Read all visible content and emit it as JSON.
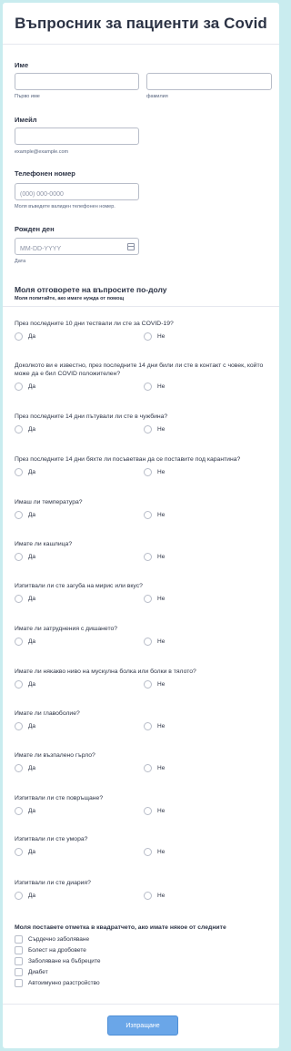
{
  "form": {
    "title": "Въпросник за пациенти за Covid",
    "name": {
      "label": "Име",
      "first_sub": "Първо име",
      "last_sub": "фамилия",
      "first_value": "",
      "last_value": ""
    },
    "email": {
      "label": "Имейл",
      "sub": "example@example.com",
      "value": ""
    },
    "phone": {
      "label": "Телефонен номер",
      "placeholder": "(000) 000-0000",
      "sub": "Моля въведете валиден телефонен номер.",
      "value": ""
    },
    "birthday": {
      "label": "Рожден ден",
      "placeholder": "MM-DD-YYYY",
      "sub": "Дата",
      "icon": "calendar-icon"
    },
    "section": {
      "title": "Моля отговорете на въпросите по-долу",
      "subtitle": "Моля попитайте, ако имате нужда от помощ"
    },
    "yes_label": "Да",
    "no_label": "Не",
    "questions": [
      "През последните 10 дни тествали ли сте за COVID-19?",
      "Доколкото ви е известно, през последните 14 дни били ли сте в контакт с човек, който може да е бил COVID положителен?",
      "През последните 14 дни пътували ли сте в чужбина?",
      "През последните 14 дни бяхте ли посъветван да се поставите под карантина?",
      "Имаш ли температура?",
      "Имате ли кашлица?",
      "Изпитвали ли сте загуба на мирис или вкус?",
      "Имате ли затруднения с дишането?",
      "Имате ли някакво ниво на мускулна болка или болки в тялото?",
      "Имате ли главоболие?",
      "Имате ли възпалено гърло?",
      "Изпитвали ли сте повръщане?",
      "Изпитвали ли сте умора?",
      "Изпитвали ли сте диария?"
    ],
    "conditions": {
      "label": "Моля поставете отметка в квадратчето, ако имате някое от следните",
      "items": [
        "Сърдечно заболяване",
        "Болест на дробовете",
        "Заболяване на бъбреците",
        "Диабет",
        "Автоимунно разстройство"
      ]
    },
    "submit_label": "Изпращане"
  }
}
